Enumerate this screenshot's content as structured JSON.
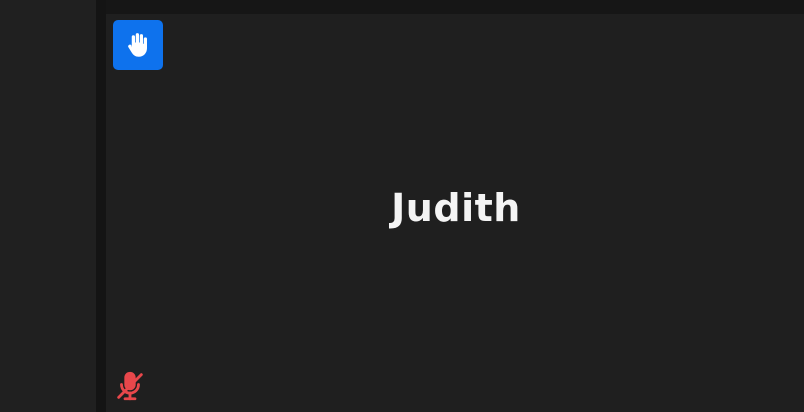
{
  "participant": {
    "name": "Judith",
    "hand_raised": true,
    "mic_muted": true
  },
  "icons": {
    "raise_hand": "hand-icon",
    "mic_muted": "muted-microphone-icon"
  },
  "colors": {
    "background": "#1f1f1f",
    "raise_hand_badge": "#0e72ed",
    "muted_icon": "#e8474b",
    "name_text": "#f4f4f4"
  }
}
